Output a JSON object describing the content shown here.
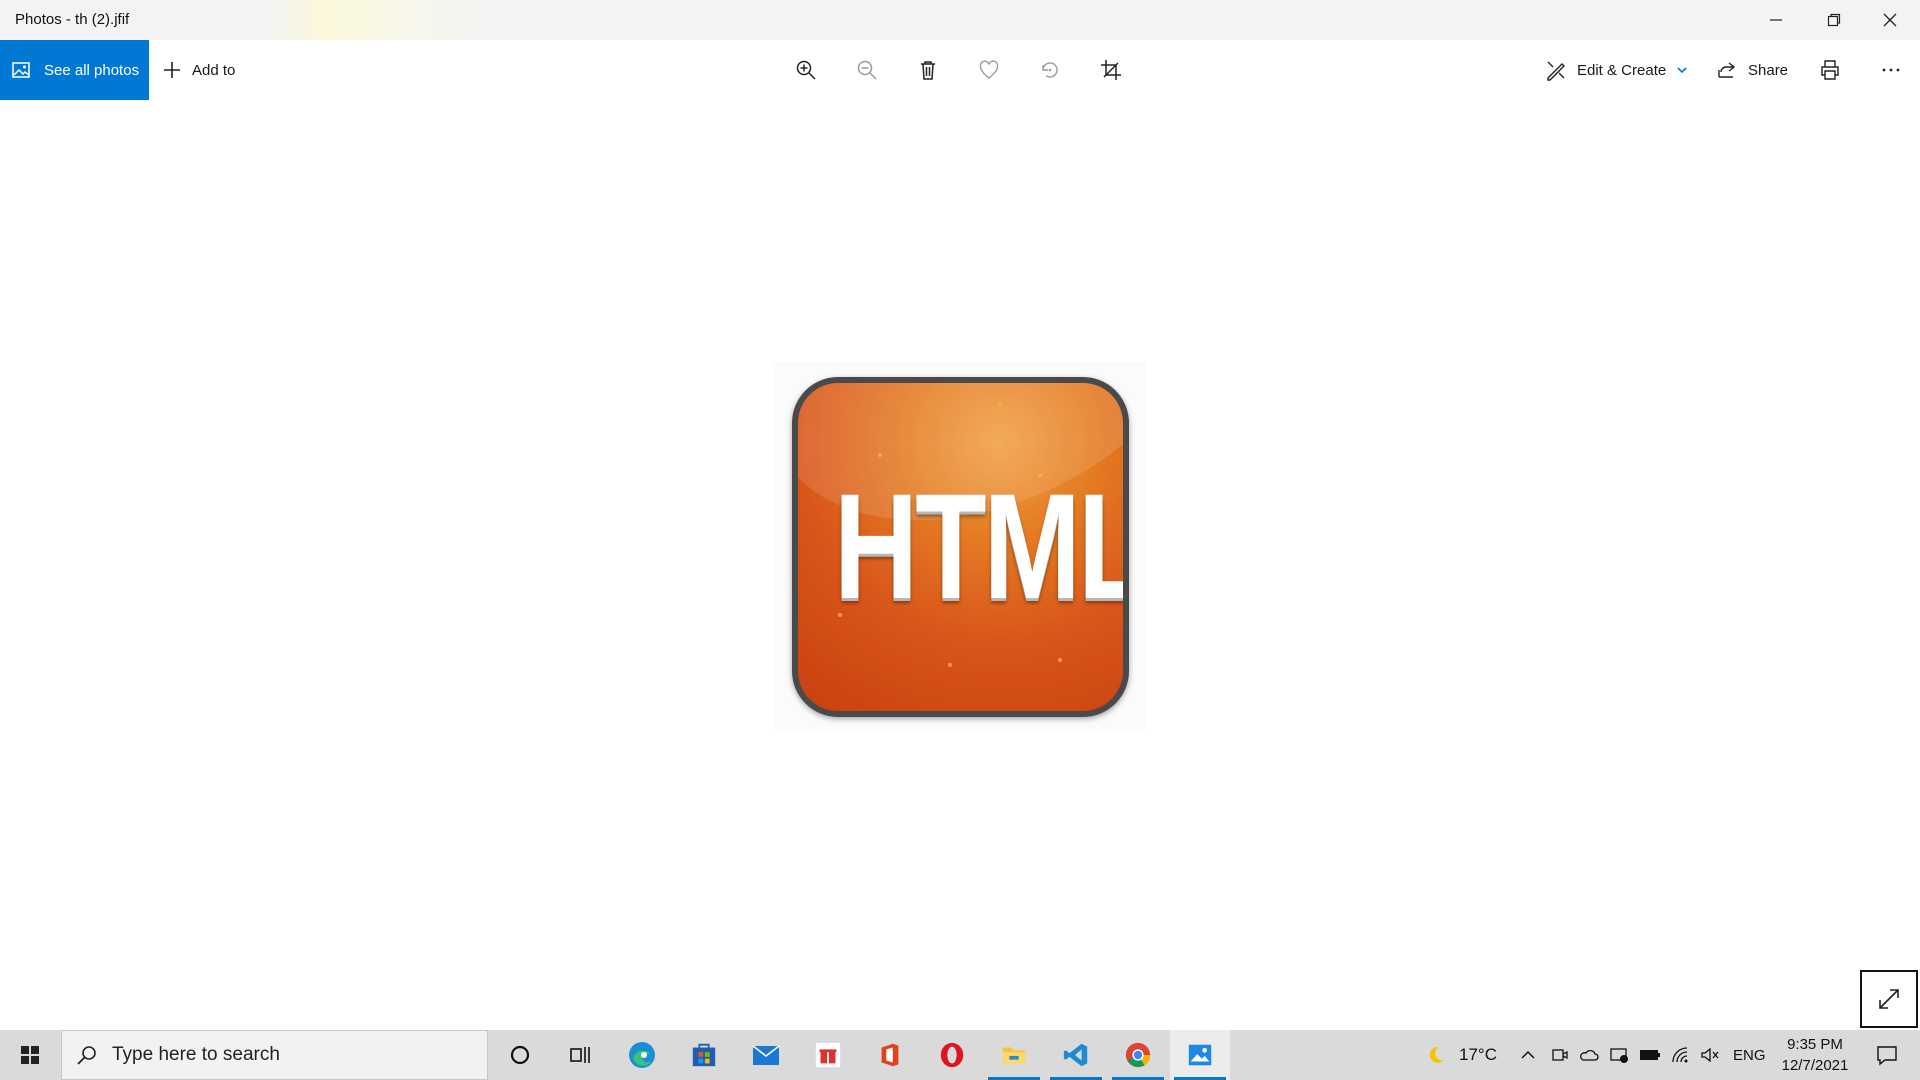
{
  "window": {
    "title": "Photos - th (2).jfif"
  },
  "toolbar": {
    "see_all_label": "See all photos",
    "add_to_label": "Add to",
    "edit_create_label": "Edit & Create",
    "share_label": "Share"
  },
  "photo": {
    "text": "HTML"
  },
  "taskbar": {
    "search_placeholder": "Type here to search",
    "weather": "17°C",
    "language": "ENG",
    "time": "9:35 PM",
    "date": "12/7/2021"
  },
  "colors": {
    "accent": "#0078d4",
    "icon_orange": "#d9551a",
    "taskbar": "#dadada"
  }
}
